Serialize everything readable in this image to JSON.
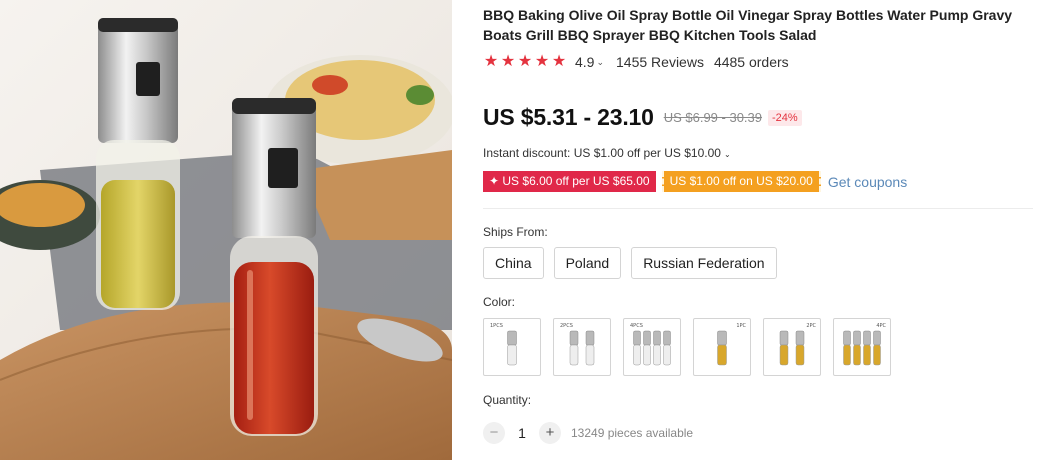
{
  "product": {
    "title": "BBQ Baking Olive Oil Spray Bottle Oil Vinegar Spray Bottles Water Pump Gravy Boats Grill BBQ Sprayer BBQ Kitchen Tools Salad",
    "image_icon": "oil-sprayer-product-photo"
  },
  "rating": {
    "stars_filled": 5,
    "star_glyph": "★",
    "value": "4.9",
    "chevron": "⌄",
    "reviews": "1455 Reviews",
    "orders": "4485 orders"
  },
  "price": {
    "current": "US $5.31 - 23.10",
    "original": "US $6.99 - 30.39",
    "discount": "-24%"
  },
  "instant_discount": {
    "text": "Instant discount: US $1.00 off per US $10.00",
    "chevron": "⌄"
  },
  "coupons": {
    "items": [
      {
        "text": "✦ US $6.00 off per US $65.00",
        "color": "#e02849"
      },
      {
        "text": "US $1.00 off on US $20.00",
        "color": "#f4a020"
      }
    ],
    "get_link": "Get coupons"
  },
  "ships_from": {
    "label": "Ships From:",
    "options": [
      "China",
      "Poland",
      "Russian Federation"
    ]
  },
  "color": {
    "label": "Color:",
    "options": [
      {
        "caption": "1PCS",
        "count": 1,
        "liquid": "silver"
      },
      {
        "caption": "2PCS",
        "count": 2,
        "liquid": "silver"
      },
      {
        "caption": "4PCS",
        "count": 4,
        "liquid": "silver"
      },
      {
        "caption": "1PC",
        "count": 1,
        "liquid": "gold"
      },
      {
        "caption": "2PC",
        "count": 2,
        "liquid": "gold"
      },
      {
        "caption": "4PC",
        "count": 4,
        "liquid": "gold"
      }
    ]
  },
  "quantity": {
    "label": "Quantity:",
    "minus": "−",
    "plus": "+",
    "value": "1",
    "available": "13249 pieces available"
  },
  "colors": {
    "accent_red": "#e4333f",
    "coupon_red": "#e02849",
    "coupon_orange": "#f4a020",
    "link_blue": "#5b89b8"
  }
}
